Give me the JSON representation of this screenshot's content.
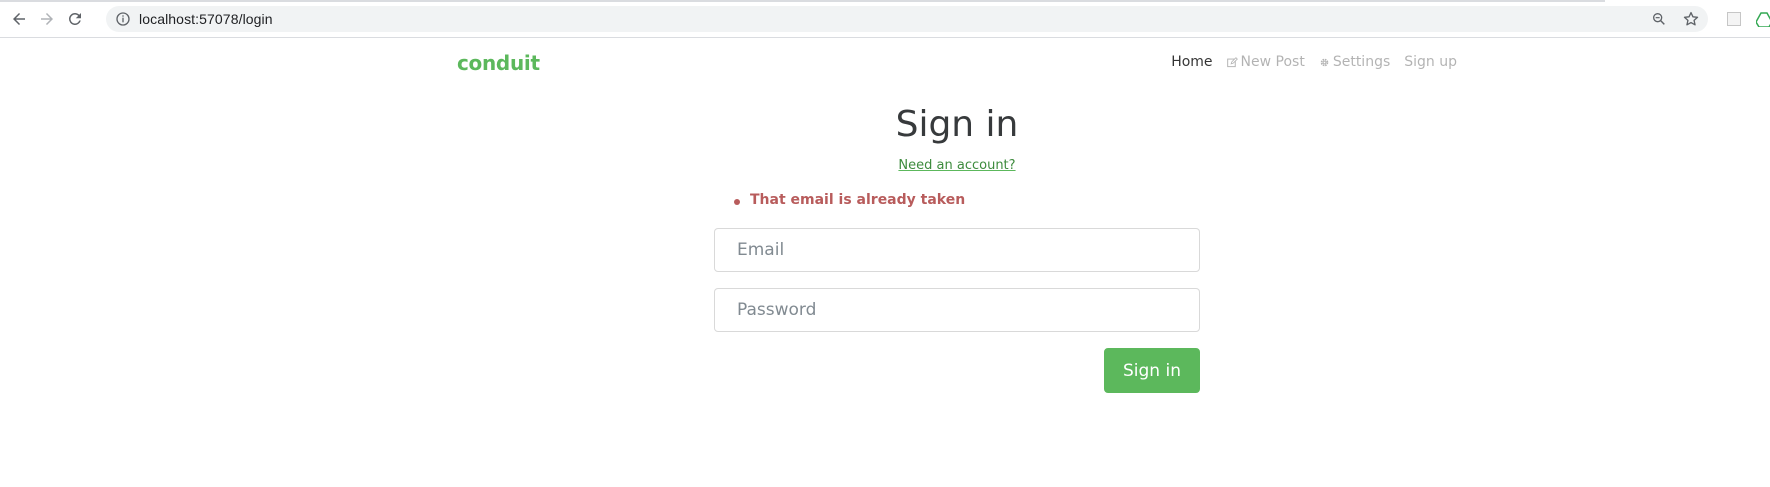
{
  "browser": {
    "url": "localhost:57078/login",
    "icons": [
      "back-arrow-icon",
      "forward-arrow-icon",
      "reload-icon",
      "info-icon",
      "zoom-icon",
      "star-icon"
    ]
  },
  "navbar": {
    "brand": "conduit",
    "links": [
      {
        "label": "Home",
        "active": true
      },
      {
        "label": "New Post",
        "icon": "edit-icon"
      },
      {
        "label": "Settings",
        "icon": "gear-icon"
      },
      {
        "label": "Sign up"
      }
    ]
  },
  "auth": {
    "title": "Sign in",
    "switch_link": "Need an account?",
    "errors": [
      "That email is already taken"
    ],
    "email_placeholder": "Email",
    "password_placeholder": "Password",
    "submit_label": "Sign in"
  },
  "colors": {
    "brand": "#5cb85c",
    "error": "#b85c5c"
  }
}
